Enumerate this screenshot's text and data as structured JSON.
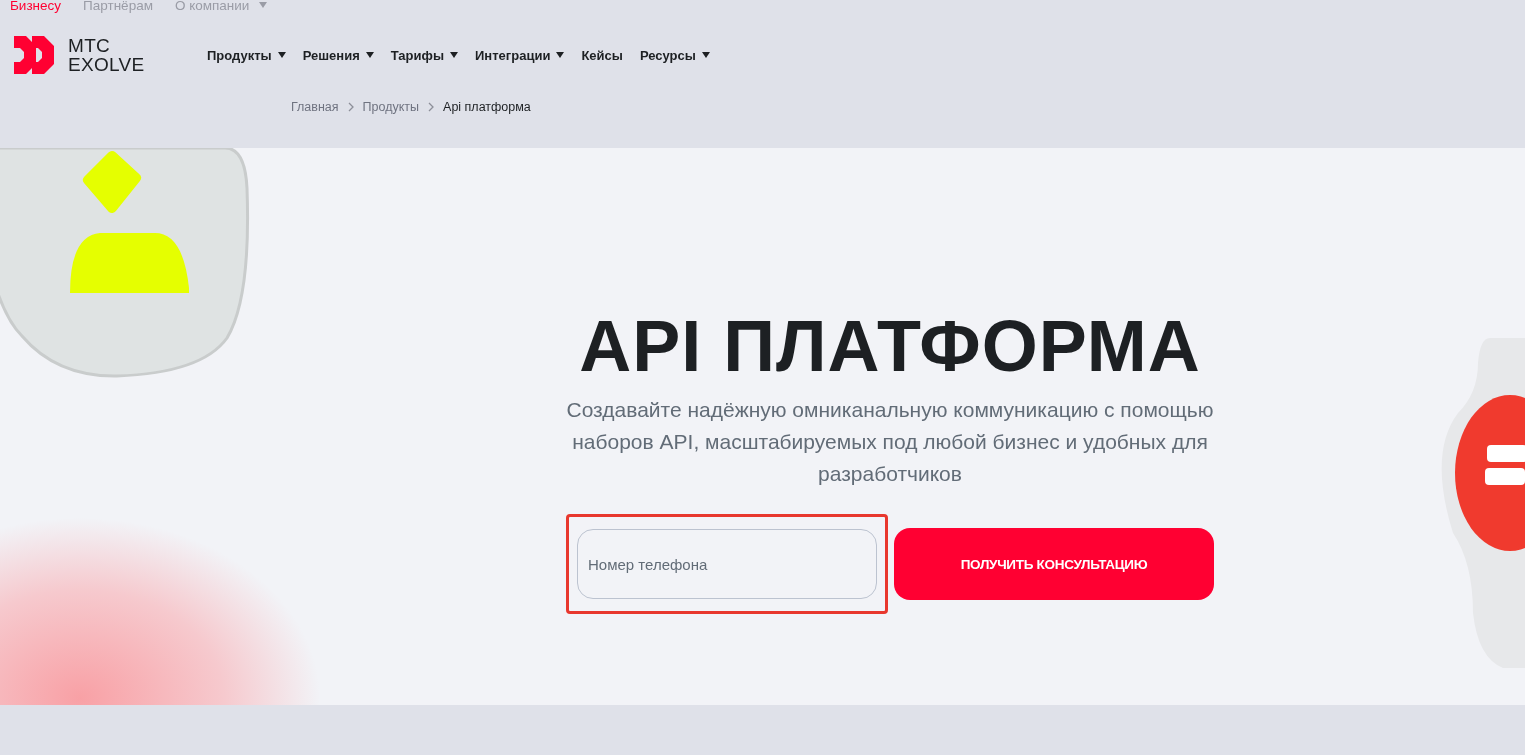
{
  "top_links": [
    {
      "label": "Бизнесу",
      "selected": true,
      "has_menu": false
    },
    {
      "label": "Партнёрам",
      "selected": false,
      "has_menu": false
    },
    {
      "label": "О компании",
      "selected": false,
      "has_menu": true
    }
  ],
  "logo": {
    "line1": "МТС",
    "line2": "EXOLVE"
  },
  "nav": [
    {
      "label": "Продукты",
      "has_menu": true
    },
    {
      "label": "Решения",
      "has_menu": true
    },
    {
      "label": "Тарифы",
      "has_menu": true
    },
    {
      "label": "Интеграции",
      "has_menu": true
    },
    {
      "label": "Кейсы",
      "has_menu": false
    },
    {
      "label": "Ресурсы",
      "has_menu": true
    }
  ],
  "breadcrumbs": [
    {
      "label": "Главная",
      "current": false
    },
    {
      "label": "Продукты",
      "current": false
    },
    {
      "label": "Api платформа",
      "current": true
    }
  ],
  "hero": {
    "title": "API ПЛАТФОРМА",
    "subtitle": "Создавайте надёжную омниканальную коммуникацию с помощью наборов API, масштабируемых под любой бизнес и удобных для разработчиков",
    "phone_field": {
      "placeholder": "Номер телефона",
      "highlighted": true
    },
    "button": "ПОЛУЧИТЬ КОНСУЛЬТАЦИЮ"
  }
}
